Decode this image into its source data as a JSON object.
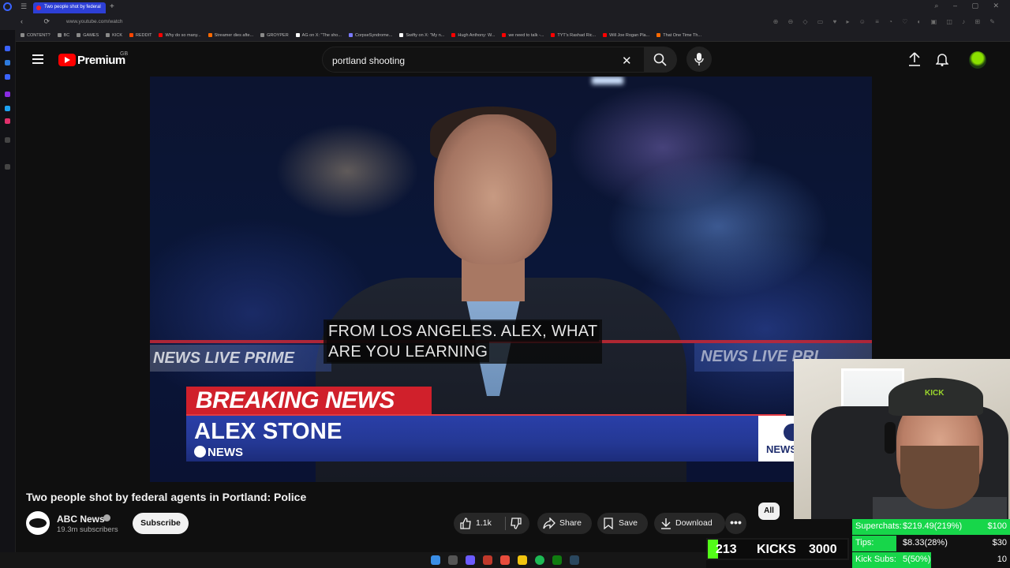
{
  "browser": {
    "tab_title": "Two people shot by federal",
    "new_tab_symbol": "+",
    "url": "www.youtube.com/watch",
    "bookmarks": [
      {
        "label": "CONTENT?",
        "color": "#8a8a8a"
      },
      {
        "label": "BC",
        "color": "#8a8a8a"
      },
      {
        "label": "GAMES",
        "color": "#8a8a8a"
      },
      {
        "label": "KICK",
        "color": "#8a8a8a"
      },
      {
        "label": "REDDIT",
        "color": "#ff4500"
      },
      {
        "label": "Why do so many...",
        "color": "#ff0000"
      },
      {
        "label": "Streamer dies afte...",
        "color": "#ff6a00"
      },
      {
        "label": "GROYPER",
        "color": "#8a8a8a"
      },
      {
        "label": "AG on X: \"The sho...",
        "color": "#ffffff"
      },
      {
        "label": "CorpseSyndrome...",
        "color": "#7a7aff"
      },
      {
        "label": "Swifty on X: \"My n...",
        "color": "#ffffff"
      },
      {
        "label": "Hugh Anthony: W...",
        "color": "#ff0000"
      },
      {
        "label": "we need to talk -...",
        "color": "#ff0000"
      },
      {
        "label": "TYT's Rashad Ric...",
        "color": "#ff0000"
      },
      {
        "label": "Will Joe Rogan Pla...",
        "color": "#ff0000"
      },
      {
        "label": "That One Time Th...",
        "color": "#ff6a00"
      }
    ]
  },
  "header": {
    "brand": "Premium",
    "country": "GB",
    "search_query": "portland shooting"
  },
  "video": {
    "caption_line1": "FROM LOS ANGELES. ALEX, WHAT",
    "caption_line2": "ARE YOU LEARNING",
    "banner": "BREAKING NEWS",
    "reporter": "ALEX STONE",
    "network": "NEWS",
    "ticker_left": "NEWS LIVE PRIME",
    "ticker_right": "NEWS LIVE PRI",
    "badge_text": "NEWS",
    "webcam_cap_text": "KICK"
  },
  "info": {
    "title": "Two people shot by federal agents in Portland: Police",
    "channel": "ABC News",
    "subscribers": "19.3m subscribers",
    "subscribe_label": "Subscribe",
    "likes": "1.1k",
    "share_label": "Share",
    "save_label": "Save",
    "download_label": "Download",
    "more_label": "•••",
    "chip_all": "All"
  },
  "overlay": {
    "kicks_current": "213",
    "kicks_label": "KICKS",
    "kicks_goal": "3000",
    "kicks_progress": 0.071,
    "goals": [
      {
        "label": "Superchats:",
        "value": "$219.49(219%)",
        "target": "$100",
        "progress": 1.0
      },
      {
        "label": "Tips:",
        "value": "$8.33(28%)",
        "target": "$30",
        "progress": 0.28
      },
      {
        "label": "Kick Subs:",
        "value": "5(50%)",
        "target": "10",
        "progress": 0.5
      }
    ]
  },
  "colors": {
    "youtube_red": "#ff0000",
    "kick_green": "#53fc18",
    "goal_green": "#17d64a",
    "breaking_red": "#d0202b",
    "abc_blue": "#243894"
  }
}
